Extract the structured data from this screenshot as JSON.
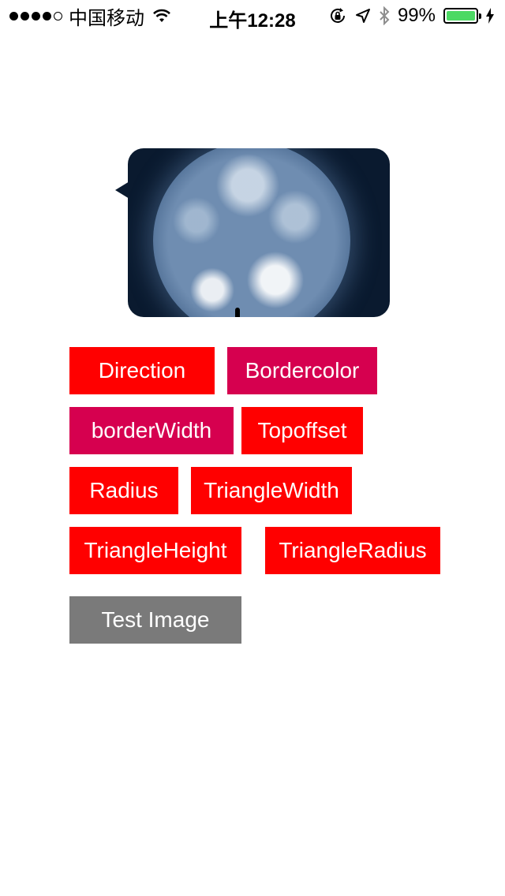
{
  "status_bar": {
    "carrier": "中国移动",
    "time": "上午12:28",
    "battery_percent": "99%",
    "battery_level": 0.99,
    "icons": [
      "signal-dots-icon",
      "wifi-icon",
      "orientation-lock-icon",
      "location-icon",
      "bluetooth-icon",
      "battery-icon",
      "charging-bolt-icon"
    ]
  },
  "bubble": {
    "image": "earth-photo"
  },
  "buttons": {
    "direction": "Direction",
    "bordercolor": "Bordercolor",
    "border_width": "borderWidth",
    "topoffset": "Topoffset",
    "radius": "Radius",
    "triangle_width": "TriangleWidth",
    "triangle_height": "TriangleHeight",
    "triangle_radius": "TriangleRadius",
    "test_image": "Test Image"
  },
  "colors": {
    "red": "#ff0000",
    "crimson": "#d6004f",
    "gray": "#7a7a7a",
    "battery_green": "#4cd964",
    "bubble_bg": "#0a1a2f"
  }
}
